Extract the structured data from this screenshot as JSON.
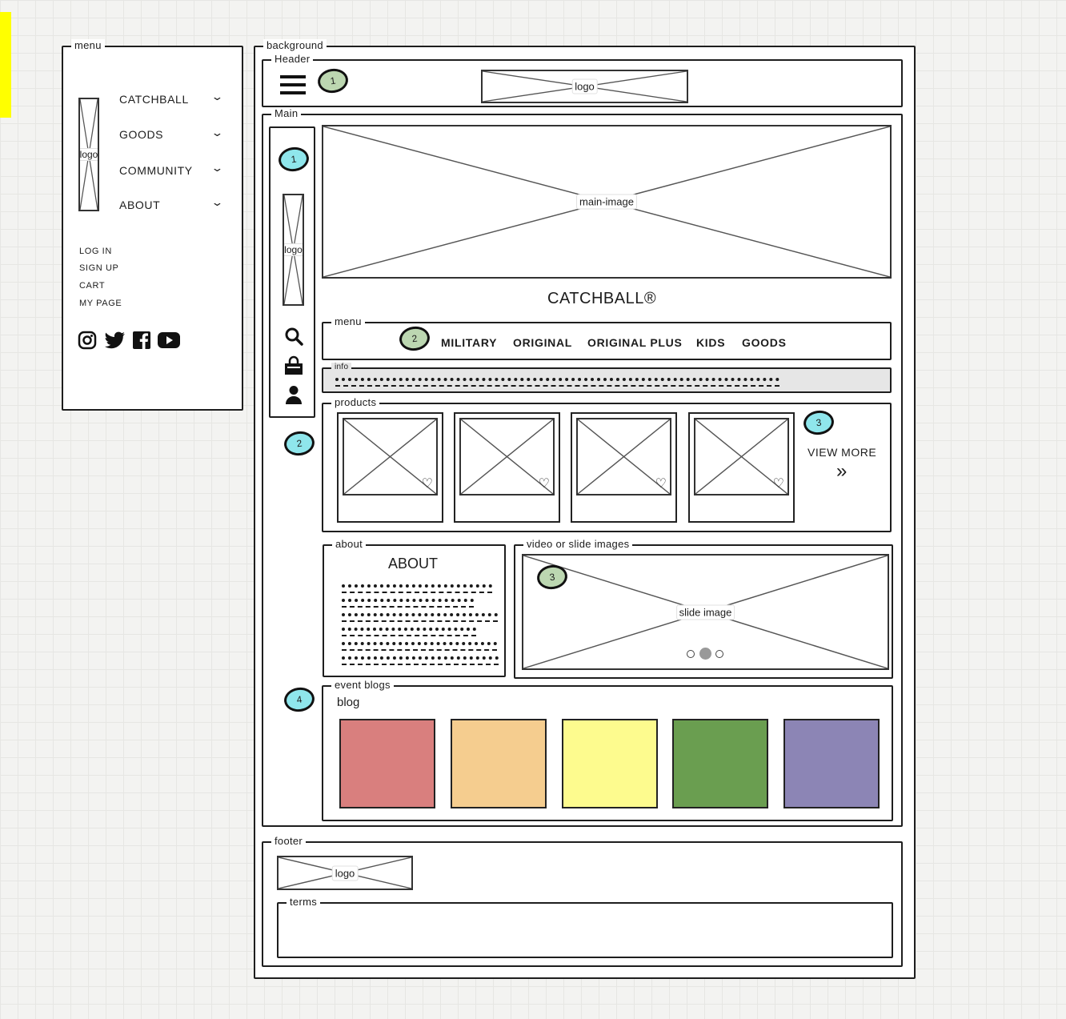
{
  "sidebar_menu": {
    "legend": "menu",
    "logo_label": "logo",
    "nav_items": [
      {
        "label": "CATCHBALL"
      },
      {
        "label": "GOODS"
      },
      {
        "label": "COMMUNITY"
      },
      {
        "label": "ABOUT"
      }
    ],
    "account_links": [
      {
        "label": "LOG IN"
      },
      {
        "label": "SIGN UP"
      },
      {
        "label": "CART"
      },
      {
        "label": "MY PAGE"
      }
    ],
    "social_icons": [
      "instagram-icon",
      "twitter-icon",
      "facebook-icon",
      "youtube-icon"
    ]
  },
  "background": {
    "legend": "background",
    "header": {
      "legend": "Header",
      "badge": "1",
      "logo_label": "logo"
    },
    "main": {
      "legend": "Main",
      "side_badge_1": "1",
      "side_badge_2": "2",
      "side_badge_4": "4",
      "side_logo_label": "logo",
      "main_image_label": "main-image",
      "brand_title": "CATCHBALL®",
      "menu": {
        "legend": "menu",
        "badge": "2",
        "items": [
          {
            "label": "MILITARY"
          },
          {
            "label": "ORIGINAL"
          },
          {
            "label": "ORIGINAL PLUS"
          },
          {
            "label": "KIDS"
          },
          {
            "label": "GOODS"
          }
        ]
      },
      "info": {
        "legend": "info"
      },
      "products": {
        "legend": "products",
        "badge": "3",
        "view_more": "VIEW MORE",
        "view_more_arrow": "»",
        "count": 4
      },
      "about": {
        "legend": "about",
        "title": "ABOUT"
      },
      "slides": {
        "legend": "video or slide images",
        "badge": "3",
        "image_label": "slide image",
        "dots": 3,
        "active_dot": 2
      },
      "event_blogs": {
        "legend": "event blogs",
        "title": "blog",
        "colors": [
          "#d97f7e",
          "#f5cd8f",
          "#fdfb8e",
          "#6a9e50",
          "#8c85b5"
        ]
      }
    },
    "footer": {
      "legend": "footer",
      "logo_label": "logo",
      "terms_legend": "terms"
    }
  }
}
